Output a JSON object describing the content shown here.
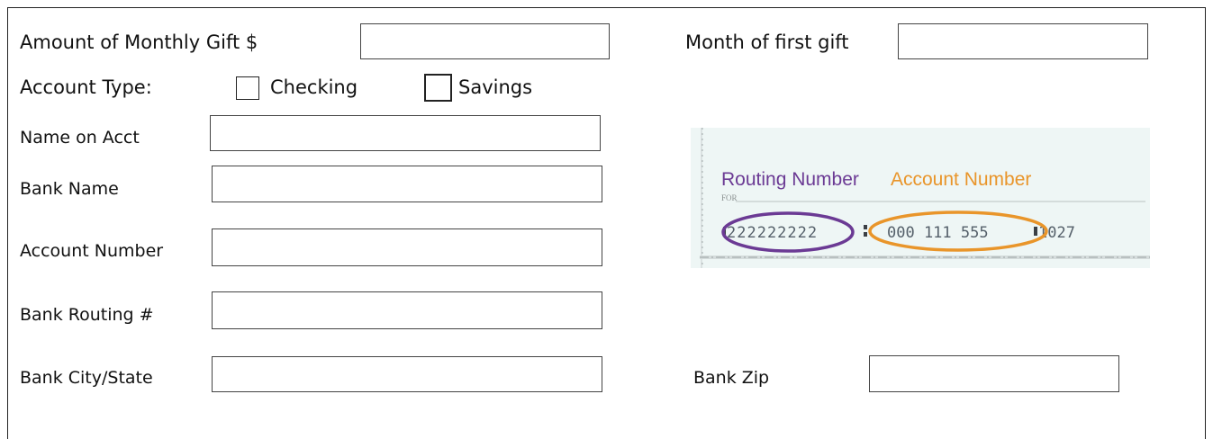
{
  "form": {
    "monthly_gift": {
      "label": "Amount of Monthly Gift $",
      "value": ""
    },
    "first_month": {
      "label": "Month of first gift",
      "value": ""
    },
    "account_type": {
      "label": "Account Type:",
      "options": [
        {
          "label": "Checking",
          "checked": false
        },
        {
          "label": "Savings",
          "checked": false
        }
      ]
    },
    "name_on_acct": {
      "label": "Name on Acct",
      "value": ""
    },
    "bank_name": {
      "label": "Bank Name",
      "value": ""
    },
    "account_number": {
      "label": "Account Number",
      "value": ""
    },
    "routing": {
      "label": "Bank Routing #",
      "value": ""
    },
    "city_state": {
      "label": "Bank City/State",
      "value": ""
    },
    "zip": {
      "label": "Bank Zip",
      "value": ""
    }
  },
  "check_example": {
    "routing_label": "Routing Number",
    "account_label": "Account Number",
    "for_text": "FOR",
    "routing_digits": "222222222",
    "account_digits": "000 111 555",
    "check_number": "1027",
    "colors": {
      "routing": "#6b3a94",
      "account": "#e9952a",
      "paper": "#eef6f5"
    }
  }
}
